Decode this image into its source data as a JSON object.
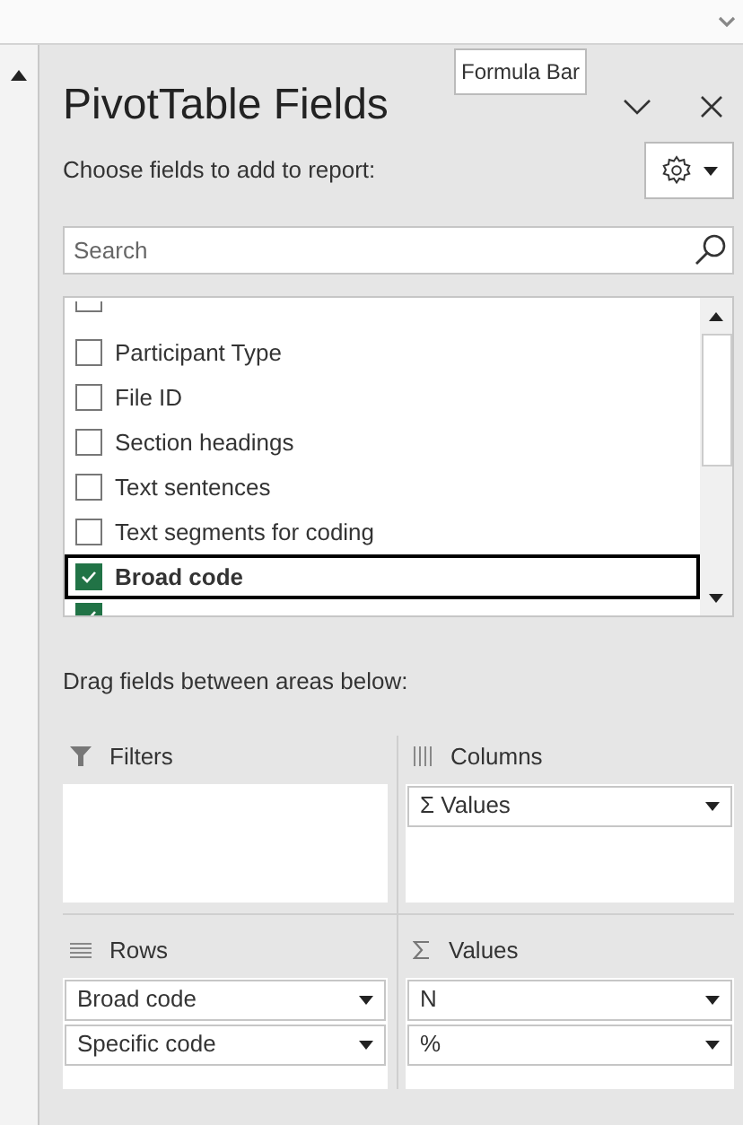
{
  "tooltip": "Formula Bar",
  "title": "PivotTable Fields",
  "subtitle": "Choose fields to add to report:",
  "search": {
    "placeholder": "Search"
  },
  "fields": [
    {
      "checked": false
    },
    {
      "label": "Participant Type",
      "checked": false,
      "selected": false
    },
    {
      "label": "File ID",
      "checked": false,
      "selected": false
    },
    {
      "label": "Section headings",
      "checked": false,
      "selected": false
    },
    {
      "label": "Text sentences",
      "checked": false,
      "selected": false
    },
    {
      "label": "Text segments for coding",
      "checked": false,
      "selected": false
    },
    {
      "label": "Broad code",
      "checked": true,
      "selected": true
    },
    {
      "checked": true
    }
  ],
  "areas_hint": "Drag fields between areas below:",
  "areas": [
    {
      "kind": "filters",
      "label": "Filters"
    },
    {
      "kind": "columns",
      "label": "Columns",
      "items": [
        "Σ Values"
      ]
    },
    {
      "kind": "rows",
      "label": "Rows",
      "items": [
        "Broad code",
        "Specific code"
      ]
    },
    {
      "kind": "values",
      "label": "Values",
      "items": [
        "N",
        "%"
      ]
    }
  ]
}
